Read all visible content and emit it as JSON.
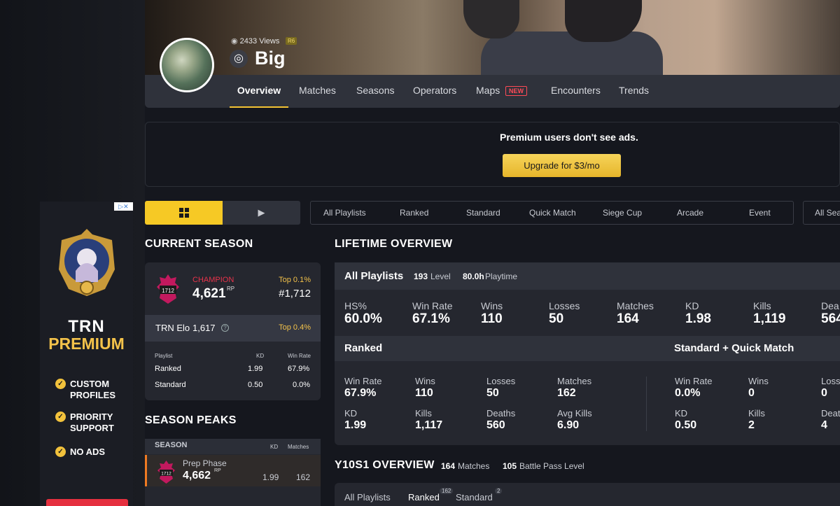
{
  "profile": {
    "views": "2433 Views",
    "platform_badge": "R6",
    "name": "Big",
    "platform_icon": "ubisoft-icon"
  },
  "tabs": [
    "Overview",
    "Matches",
    "Seasons",
    "Operators",
    "Maps",
    "Encounters",
    "Trends"
  ],
  "maps_badge": "NEW",
  "promo": {
    "text": "Premium users don't see ads.",
    "button": "Upgrade for $3/mo"
  },
  "ad": {
    "brand": "TRN",
    "product": "PREMIUM",
    "perks": [
      [
        "CUSTOM",
        "PROFILES"
      ],
      [
        "PRIORITY",
        "SUPPORT"
      ],
      [
        "NO ADS"
      ]
    ]
  },
  "platforms": {
    "pc": "windows-icon",
    "ps": "playstation-icon"
  },
  "playlists": [
    "All Playlists",
    "Ranked",
    "Standard",
    "Quick Match",
    "Siege Cup",
    "Arcade",
    "Event"
  ],
  "season_select": "All Sea",
  "current_season": {
    "title": "CURRENT SEASON",
    "rank_name": "CHAMPION",
    "rank_num": "1712",
    "rp": "4,621",
    "rp_unit": "RP",
    "top_pct": "Top 0.1%",
    "position": "#1,712",
    "elo_label": "TRN Elo",
    "elo_value": "1,617",
    "elo_top": "Top 0.4%",
    "table_headers": [
      "Playlist",
      "KD",
      "Win Rate"
    ],
    "rows": [
      {
        "playlist": "Ranked",
        "kd": "1.99",
        "win": "67.9%"
      },
      {
        "playlist": "Standard",
        "kd": "0.50",
        "win": "0.0%"
      }
    ]
  },
  "season_peaks": {
    "title": "SEASON PEAKS",
    "headers": [
      "SEASON",
      "KD",
      "Matches"
    ],
    "row": {
      "name": "Prep Phase",
      "rank_num": "1712",
      "rp": "4,662",
      "rp_unit": "RP",
      "kd": "1.99",
      "matches": "162"
    }
  },
  "lifetime": {
    "title": "LIFETIME OVERVIEW",
    "head": "All Playlists",
    "level_num": "193",
    "level_lbl": "Level",
    "playtime_num": "80.0h",
    "playtime_lbl": "Playtime",
    "stats": [
      {
        "label": "HS%",
        "value": "60.0%"
      },
      {
        "label": "Win Rate",
        "value": "67.1%"
      },
      {
        "label": "Wins",
        "value": "110"
      },
      {
        "label": "Losses",
        "value": "50"
      },
      {
        "label": "Matches",
        "value": "164"
      },
      {
        "label": "KD",
        "value": "1.98"
      },
      {
        "label": "Kills",
        "value": "1,119"
      },
      {
        "label": "Dea",
        "value": "564"
      }
    ],
    "ranked_title": "Ranked",
    "sqm_title": "Standard + Quick Match",
    "ranked": [
      {
        "label": "Win Rate",
        "value": "67.9%"
      },
      {
        "label": "Wins",
        "value": "110"
      },
      {
        "label": "Losses",
        "value": "50"
      },
      {
        "label": "Matches",
        "value": "162"
      },
      {
        "label": "KD",
        "value": "1.99"
      },
      {
        "label": "Kills",
        "value": "1,117"
      },
      {
        "label": "Deaths",
        "value": "560"
      },
      {
        "label": "Avg Kills",
        "value": "6.90"
      }
    ],
    "sqm": [
      {
        "label": "Win Rate",
        "value": "0.0%"
      },
      {
        "label": "Wins",
        "value": "0"
      },
      {
        "label": "Loss",
        "value": "0"
      },
      {
        "label": "KD",
        "value": "0.50"
      },
      {
        "label": "Kills",
        "value": "2"
      },
      {
        "label": "Deat",
        "value": "4"
      }
    ]
  },
  "y10s1": {
    "title": "Y10S1 OVERVIEW",
    "matches_num": "164",
    "matches_lbl": "Matches",
    "bp_num": "105",
    "bp_lbl": "Battle Pass Level",
    "tabs": [
      {
        "label": "All Playlists",
        "count": ""
      },
      {
        "label": "Ranked",
        "count": "162"
      },
      {
        "label": "Standard",
        "count": "2"
      }
    ]
  }
}
